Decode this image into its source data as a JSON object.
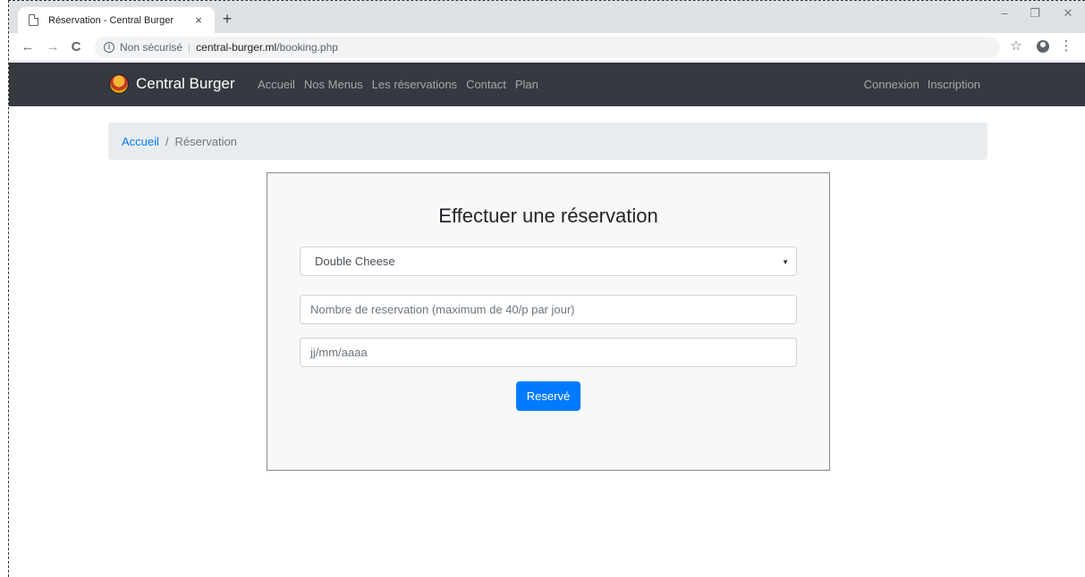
{
  "browser": {
    "tab_title": "Réservation - Central Burger",
    "tab_close": "×",
    "new_tab": "+",
    "window_controls": {
      "minimize": "–",
      "restore": "❐",
      "close": "✕"
    },
    "nav": {
      "back": "←",
      "forward": "→",
      "reload": "C"
    },
    "address": {
      "security_label": "Non sécurisé",
      "separator": "|",
      "host": "central-burger.ml",
      "path": "/booking.php"
    },
    "star": "☆",
    "menu": "⋮"
  },
  "site": {
    "brand": "Central Burger",
    "nav_left": [
      "Accueil",
      "Nos Menus",
      "Les réservations",
      "Contact",
      "Plan"
    ],
    "nav_right": [
      "Connexion",
      "Inscription"
    ]
  },
  "breadcrumb": {
    "home": "Accueil",
    "separator": "/",
    "current": "Réservation"
  },
  "form": {
    "title": "Effectuer une réservation",
    "menu_select_value": "Double Cheese",
    "caret": "▼",
    "count_placeholder": "Nombre de reservation (maximum de 40/p par jour)",
    "date_placeholder": "jj/mm/aaaa",
    "submit_label": "Reservé"
  },
  "colors": {
    "navbar": "#343a40",
    "primary": "#007bff",
    "breadcrumb_bg": "#e9ecef"
  }
}
